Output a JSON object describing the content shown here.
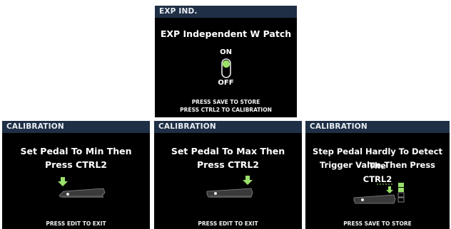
{
  "top": {
    "header": "EXP IND.",
    "title": "EXP Independent W Patch",
    "toggle": {
      "on_label": "ON",
      "off_label": "OFF",
      "state": "on"
    },
    "footer_lines": [
      "PRESS SAVE TO STORE",
      "PRESS CTRL2 TO CALIBRATION"
    ]
  },
  "calibrations": [
    {
      "header": "CALIBRATION",
      "lines": [
        "Set Pedal To Min Then",
        "Press CTRL2"
      ],
      "footer": "PRESS EDIT TO EXIT"
    },
    {
      "header": "CALIBRATION",
      "lines": [
        "Set Pedal To Max Then",
        "Press CTRL2"
      ],
      "footer": "PRESS EDIT TO EXIT"
    },
    {
      "header": "CALIBRATION",
      "lines": [
        "Step Pedal Hardly To Detect The",
        "Trigger Value,Then Press CTRL2"
      ],
      "footer": "PRESS SAVE TO STORE"
    }
  ],
  "colors": {
    "header_bg": "#1f2f45",
    "accent_green": "#9be06a",
    "screen_bg": "#000000"
  }
}
